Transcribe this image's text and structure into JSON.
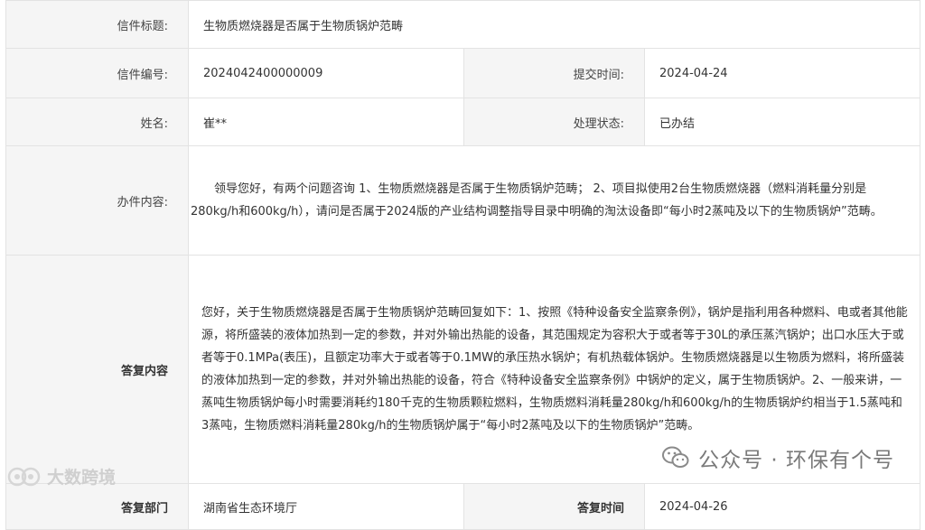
{
  "letter": {
    "title_label": "信件标题:",
    "title_value": "生物质燃烧器是否属于生物质锅炉范畴",
    "number_label": "信件编号:",
    "number_value": "2024042400000009",
    "submit_time_label": "提交时间:",
    "submit_time_value": "2024-04-24",
    "name_label": "姓名:",
    "name_value": "崔**",
    "status_label": "处理状态:",
    "status_value": "已办结",
    "content_label": "办件内容:",
    "content_value": "领导您好，有两个问题咨询 1、生物质燃烧器是否属于生物质锅炉范畴； 2、项目拟使用2台生物质燃烧器（燃料消耗量分别是280kg/h和600kg/h），请问是否属于2024版的产业结构调整指导目录中明确的淘汰设备即“每小时2蒸吨及以下的生物质锅炉”范畴。",
    "reply_label": "答复内容",
    "reply_value": "您好，关于生物质燃烧器是否属于生物质锅炉范畴回复如下：1、按照《特种设备安全监察条例》，锅炉是指利用各种燃料、电或者其他能源，将所盛装的液体加热到一定的参数，并对外输出热能的设备，其范围规定为容积大于或者等于30L的承压蒸汽锅炉；出口水压大于或者等于0.1MPa(表压)，且额定功率大于或者等于0.1MW的承压热水锅炉；有机热载体锅炉。生物质燃烧器是以生物质为燃料，将所盛装的液体加热到一定的参数，并对外输出热能的设备，符合《特种设备安全监察条例》中锅炉的定义，属于生物质锅炉。2、一般来讲，一蒸吨生物质锅炉每小时需要消耗约180千克的生物质颗粒燃料，生物质燃料消耗量280kg/h和600kg/h的生物质锅炉约相当于1.5蒸吨和3蒸吨，生物质燃料消耗量280kg/h的生物质锅炉属于“每小时2蒸吨及以下的生物质锅炉”范畴。",
    "dept_label": "答复部门",
    "dept_value": "湖南省生态环境厅",
    "reply_time_label": "答复时间",
    "reply_time_value": "2024-04-26"
  },
  "watermarks": {
    "right_text": "公众号 · 环保有个号",
    "left_text": "大数跨境"
  },
  "icons": {
    "wechat": "wechat-icon",
    "brand": "brand-logo-icon"
  },
  "colors": {
    "label_bg": "#f5f5f5",
    "border": "#e3e3e3",
    "text": "#333333"
  }
}
